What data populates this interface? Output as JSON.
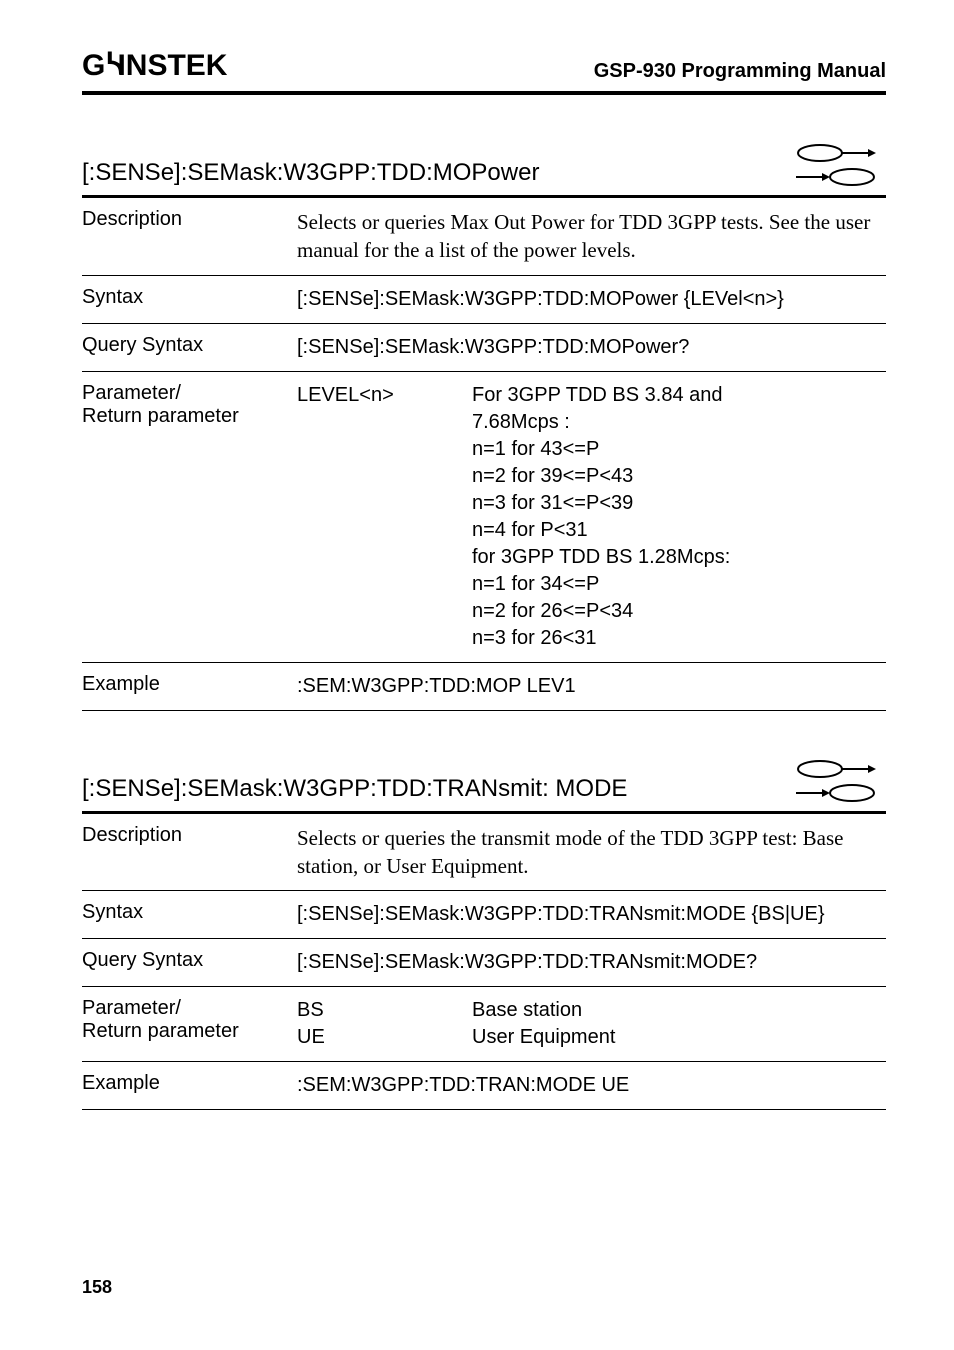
{
  "header": {
    "logo_text": "GWINSTEK",
    "title": "GSP-930 Programming Manual"
  },
  "section1": {
    "heading": "[:SENSe]:SEMask:W3GPP:TDD:MOPower",
    "rows": {
      "desc_label": "Description",
      "desc_text": "Selects or queries Max Out Power for TDD 3GPP tests. See the user manual for the a list of the power levels.",
      "syntax_label": "Syntax",
      "syntax_text": "[:SENSe]:SEMask:W3GPP:TDD:MOPower {LEVel<n>}",
      "query_label": "Query Syntax",
      "query_text": "[:SENSe]:SEMask:W3GPP:TDD:MOPower?",
      "param_label1": "Parameter/",
      "param_label2": "Return parameter",
      "param_name": "LEVEL<n>",
      "param_lines": [
        "For 3GPP TDD BS 3.84 and",
        "7.68Mcps :",
        "n=1 for 43<=P",
        "n=2 for 39<=P<43",
        "n=3 for 31<=P<39",
        "n=4 for P<31",
        "for 3GPP TDD BS 1.28Mcps:",
        "n=1 for 34<=P",
        "n=2 for 26<=P<34",
        "n=3 for 26<31"
      ],
      "example_label": "Example",
      "example_text": ":SEM:W3GPP:TDD:MOP LEV1"
    }
  },
  "section2": {
    "heading": "[:SENSe]:SEMask:W3GPP:TDD:TRANsmit: MODE",
    "rows": {
      "desc_label": "Description",
      "desc_text": "Selects or queries the transmit mode of the TDD 3GPP test: Base station, or User Equipment.",
      "syntax_label": "Syntax",
      "syntax_text": "[:SENSe]:SEMask:W3GPP:TDD:TRANsmit:MODE {BS|UE}",
      "query_label": "Query Syntax",
      "query_text": "[:SENSe]:SEMask:W3GPP:TDD:TRANsmit:MODE?",
      "param_label1": "Parameter/",
      "param_label2": "Return parameter",
      "param1_name": "BS",
      "param1_desc": "Base station",
      "param2_name": "UE",
      "param2_desc": "User Equipment",
      "example_label": "Example",
      "example_text": ":SEM:W3GPP:TDD:TRAN:MODE UE"
    }
  },
  "footer": {
    "page": "158"
  }
}
